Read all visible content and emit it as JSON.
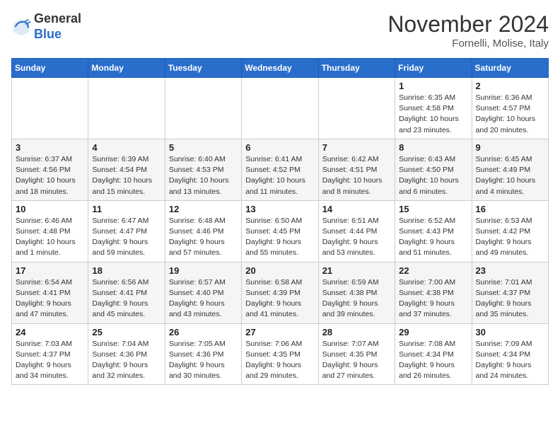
{
  "header": {
    "logo_general": "General",
    "logo_blue": "Blue",
    "month_title": "November 2024",
    "location": "Fornelli, Molise, Italy"
  },
  "calendar": {
    "days_of_week": [
      "Sunday",
      "Monday",
      "Tuesday",
      "Wednesday",
      "Thursday",
      "Friday",
      "Saturday"
    ],
    "weeks": [
      [
        {
          "day": "",
          "info": ""
        },
        {
          "day": "",
          "info": ""
        },
        {
          "day": "",
          "info": ""
        },
        {
          "day": "",
          "info": ""
        },
        {
          "day": "",
          "info": ""
        },
        {
          "day": "1",
          "info": "Sunrise: 6:35 AM\nSunset: 4:58 PM\nDaylight: 10 hours and 23 minutes."
        },
        {
          "day": "2",
          "info": "Sunrise: 6:36 AM\nSunset: 4:57 PM\nDaylight: 10 hours and 20 minutes."
        }
      ],
      [
        {
          "day": "3",
          "info": "Sunrise: 6:37 AM\nSunset: 4:56 PM\nDaylight: 10 hours and 18 minutes."
        },
        {
          "day": "4",
          "info": "Sunrise: 6:39 AM\nSunset: 4:54 PM\nDaylight: 10 hours and 15 minutes."
        },
        {
          "day": "5",
          "info": "Sunrise: 6:40 AM\nSunset: 4:53 PM\nDaylight: 10 hours and 13 minutes."
        },
        {
          "day": "6",
          "info": "Sunrise: 6:41 AM\nSunset: 4:52 PM\nDaylight: 10 hours and 11 minutes."
        },
        {
          "day": "7",
          "info": "Sunrise: 6:42 AM\nSunset: 4:51 PM\nDaylight: 10 hours and 8 minutes."
        },
        {
          "day": "8",
          "info": "Sunrise: 6:43 AM\nSunset: 4:50 PM\nDaylight: 10 hours and 6 minutes."
        },
        {
          "day": "9",
          "info": "Sunrise: 6:45 AM\nSunset: 4:49 PM\nDaylight: 10 hours and 4 minutes."
        }
      ],
      [
        {
          "day": "10",
          "info": "Sunrise: 6:46 AM\nSunset: 4:48 PM\nDaylight: 10 hours and 1 minute."
        },
        {
          "day": "11",
          "info": "Sunrise: 6:47 AM\nSunset: 4:47 PM\nDaylight: 9 hours and 59 minutes."
        },
        {
          "day": "12",
          "info": "Sunrise: 6:48 AM\nSunset: 4:46 PM\nDaylight: 9 hours and 57 minutes."
        },
        {
          "day": "13",
          "info": "Sunrise: 6:50 AM\nSunset: 4:45 PM\nDaylight: 9 hours and 55 minutes."
        },
        {
          "day": "14",
          "info": "Sunrise: 6:51 AM\nSunset: 4:44 PM\nDaylight: 9 hours and 53 minutes."
        },
        {
          "day": "15",
          "info": "Sunrise: 6:52 AM\nSunset: 4:43 PM\nDaylight: 9 hours and 51 minutes."
        },
        {
          "day": "16",
          "info": "Sunrise: 6:53 AM\nSunset: 4:42 PM\nDaylight: 9 hours and 49 minutes."
        }
      ],
      [
        {
          "day": "17",
          "info": "Sunrise: 6:54 AM\nSunset: 4:41 PM\nDaylight: 9 hours and 47 minutes."
        },
        {
          "day": "18",
          "info": "Sunrise: 6:56 AM\nSunset: 4:41 PM\nDaylight: 9 hours and 45 minutes."
        },
        {
          "day": "19",
          "info": "Sunrise: 6:57 AM\nSunset: 4:40 PM\nDaylight: 9 hours and 43 minutes."
        },
        {
          "day": "20",
          "info": "Sunrise: 6:58 AM\nSunset: 4:39 PM\nDaylight: 9 hours and 41 minutes."
        },
        {
          "day": "21",
          "info": "Sunrise: 6:59 AM\nSunset: 4:38 PM\nDaylight: 9 hours and 39 minutes."
        },
        {
          "day": "22",
          "info": "Sunrise: 7:00 AM\nSunset: 4:38 PM\nDaylight: 9 hours and 37 minutes."
        },
        {
          "day": "23",
          "info": "Sunrise: 7:01 AM\nSunset: 4:37 PM\nDaylight: 9 hours and 35 minutes."
        }
      ],
      [
        {
          "day": "24",
          "info": "Sunrise: 7:03 AM\nSunset: 4:37 PM\nDaylight: 9 hours and 34 minutes."
        },
        {
          "day": "25",
          "info": "Sunrise: 7:04 AM\nSunset: 4:36 PM\nDaylight: 9 hours and 32 minutes."
        },
        {
          "day": "26",
          "info": "Sunrise: 7:05 AM\nSunset: 4:36 PM\nDaylight: 9 hours and 30 minutes."
        },
        {
          "day": "27",
          "info": "Sunrise: 7:06 AM\nSunset: 4:35 PM\nDaylight: 9 hours and 29 minutes."
        },
        {
          "day": "28",
          "info": "Sunrise: 7:07 AM\nSunset: 4:35 PM\nDaylight: 9 hours and 27 minutes."
        },
        {
          "day": "29",
          "info": "Sunrise: 7:08 AM\nSunset: 4:34 PM\nDaylight: 9 hours and 26 minutes."
        },
        {
          "day": "30",
          "info": "Sunrise: 7:09 AM\nSunset: 4:34 PM\nDaylight: 9 hours and 24 minutes."
        }
      ]
    ]
  }
}
